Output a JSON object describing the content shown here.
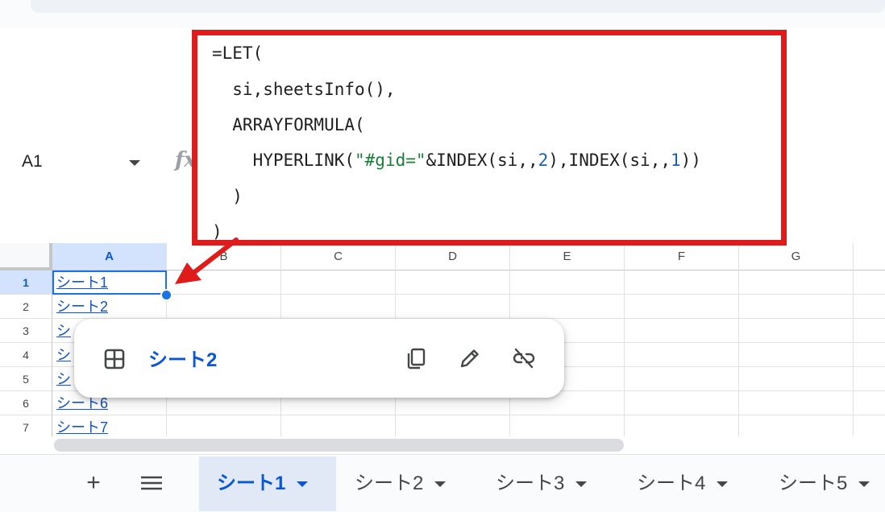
{
  "name_box": {
    "value": "A1"
  },
  "formula": {
    "line1": "=LET(",
    "line2": "  si,sheetsInfo(),",
    "line3": "  ARRAYFORMULA(",
    "line4_a": "    HYPERLINK(",
    "line4_str": "\"#gid=\"",
    "line4_b": "&INDEX(si,,",
    "line4_n1": "2",
    "line4_c": "),INDEX(si,,",
    "line4_n2": "1",
    "line4_d": "))",
    "line5": "  )",
    "line6": ")"
  },
  "columns": [
    "A",
    "B",
    "C",
    "D",
    "E",
    "F",
    "G"
  ],
  "rows": [
    "1",
    "2",
    "3",
    "4",
    "5",
    "6",
    "7"
  ],
  "column_a": [
    "シート1",
    "シート2",
    "シ",
    "シ",
    "シ",
    "シート6",
    "シート7"
  ],
  "link_popup": {
    "text": "シート2"
  },
  "icons": {
    "popup_sheet": "grid-icon",
    "popup_copy": "copy-icon",
    "popup_edit": "pencil-icon",
    "popup_unlink": "link-off-icon",
    "add_sheet": "plus-icon",
    "all_sheets": "menu-icon"
  },
  "sheet_tabs": [
    "シート1",
    "シート2",
    "シート3",
    "シート4",
    "シート5"
  ],
  "active_tab": "シート1",
  "colors": {
    "accent": "#0b57d0",
    "callout": "#e01b1b",
    "selection": "#1a73e8"
  }
}
